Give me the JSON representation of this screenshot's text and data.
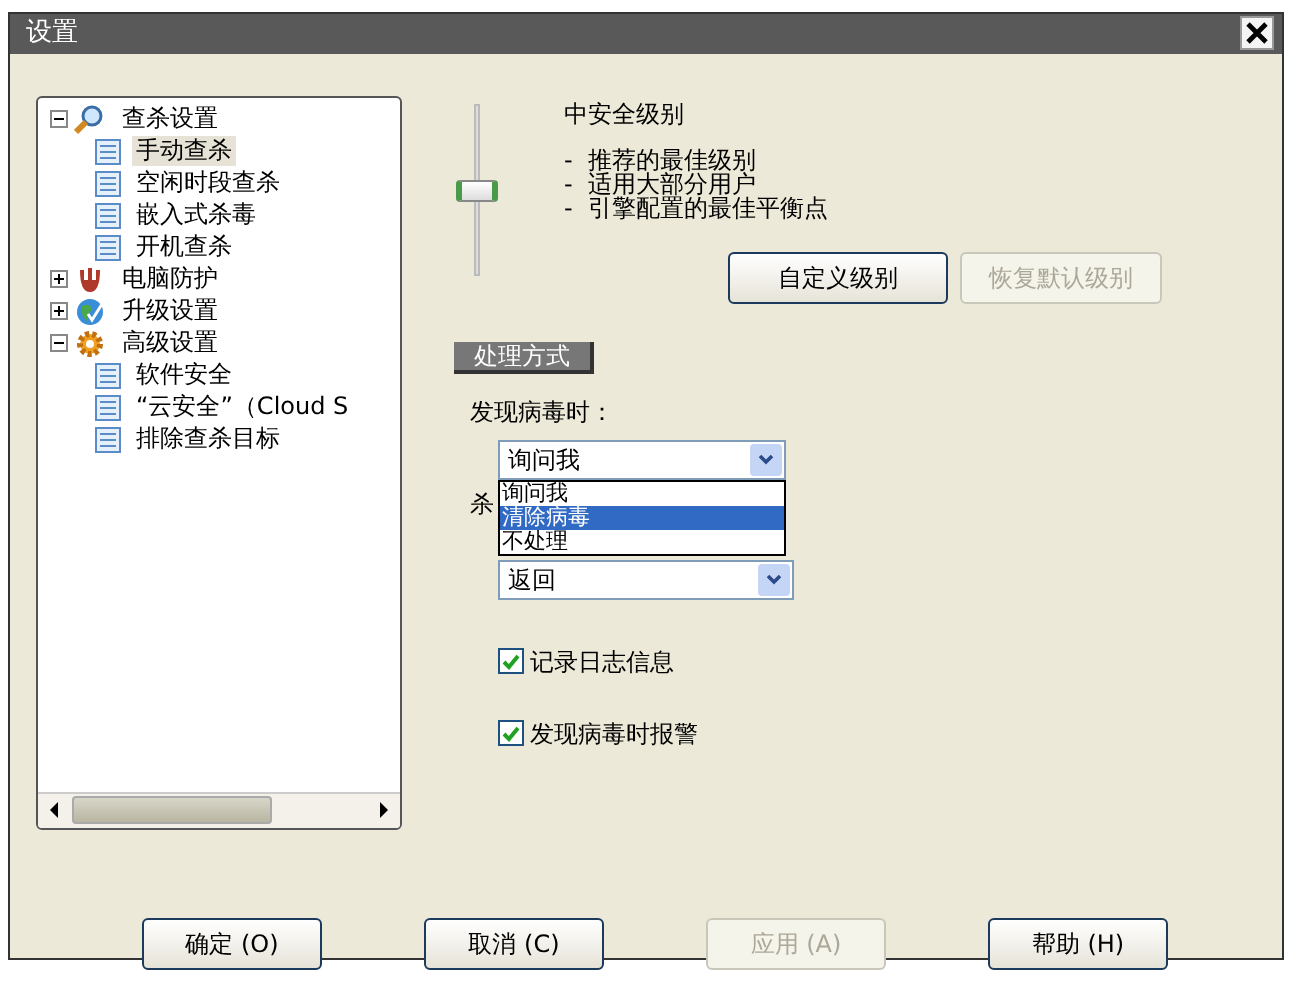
{
  "window": {
    "title": "设置"
  },
  "tree": [
    {
      "label": "查杀设置",
      "kind": "magnifier",
      "expanded": true,
      "selected": false,
      "children": [
        {
          "label": "手动查杀",
          "selected": true
        },
        {
          "label": "空闲时段查杀",
          "selected": false
        },
        {
          "label": "嵌入式杀毒",
          "selected": false
        },
        {
          "label": "开机查杀",
          "selected": false
        }
      ]
    },
    {
      "label": "电脑防护",
      "kind": "glove",
      "expanded": false,
      "selected": false
    },
    {
      "label": "升级设置",
      "kind": "globe",
      "expanded": false,
      "selected": false
    },
    {
      "label": "高级设置",
      "kind": "gear",
      "expanded": true,
      "selected": false,
      "children": [
        {
          "label": "软件安全",
          "selected": false
        },
        {
          "label": "“云安全”（Cloud S",
          "selected": false
        },
        {
          "label": "排除查杀目标",
          "selected": false
        }
      ]
    }
  ],
  "security": {
    "level": 0.5,
    "title": "中安全级别",
    "points": [
      "-  推荐的最佳级别",
      "-  适用大部分用户",
      "-  引擎配置的最佳平衡点"
    ],
    "buttons": [
      {
        "label": "自定义级别",
        "disabled": false
      },
      {
        "label": "恢复默认级别",
        "disabled": true
      }
    ]
  },
  "section_tab": "处理方式",
  "on_virus": {
    "label": "发现病毒时：",
    "value": "询问我",
    "expanded": true,
    "options": [
      {
        "label": "询问我",
        "highlighted": false
      },
      {
        "label": "清除病毒",
        "highlighted": true
      },
      {
        "label": "不处理",
        "highlighted": false
      }
    ]
  },
  "kill_fail": {
    "label": "杀",
    "value": "返回"
  },
  "checkboxes": [
    {
      "label": "记录日志信息",
      "checked": true
    },
    {
      "label": "发现病毒时报警",
      "checked": true
    }
  ],
  "footer_buttons": [
    {
      "label": "确定 (O)",
      "disabled": false
    },
    {
      "label": "取消 (C)",
      "disabled": false
    },
    {
      "label": "应用 (A)",
      "disabled": true
    },
    {
      "label": "帮助 (H)",
      "disabled": false
    }
  ]
}
